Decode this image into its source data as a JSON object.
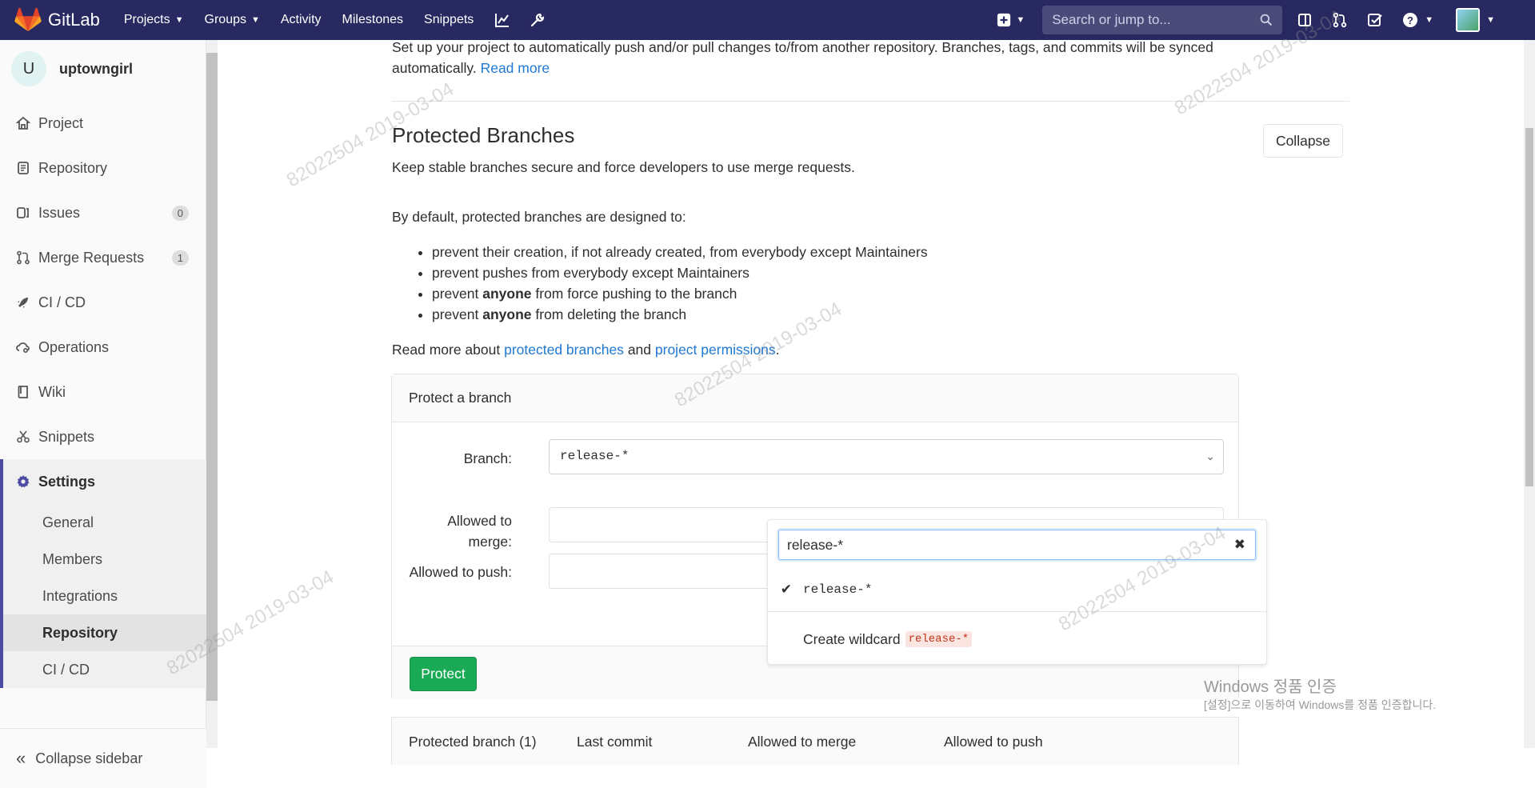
{
  "topbar": {
    "brand": "GitLab",
    "nav": [
      {
        "label": "Projects",
        "has_dropdown": true
      },
      {
        "label": "Groups",
        "has_dropdown": true
      },
      {
        "label": "Activity",
        "has_dropdown": false
      },
      {
        "label": "Milestones",
        "has_dropdown": false
      },
      {
        "label": "Snippets",
        "has_dropdown": false
      }
    ],
    "tools": [
      "chart-icon",
      "wrench-icon"
    ],
    "search_placeholder": "Search or jump to...",
    "right_icons": [
      "sidebar-toggle-icon",
      "merge-request-icon",
      "todo-icon",
      "help-icon"
    ],
    "colors": {
      "topbar": "#292961",
      "accent": "#1f78d1",
      "success": "#1aaa55"
    }
  },
  "sidebar": {
    "project_initial": "U",
    "project_name": "uptowngirl",
    "items": [
      {
        "label": "Project",
        "icon": "home-icon"
      },
      {
        "label": "Repository",
        "icon": "doc-icon"
      },
      {
        "label": "Issues",
        "icon": "issues-icon",
        "badge": "0"
      },
      {
        "label": "Merge Requests",
        "icon": "merge-request-icon",
        "badge": "1"
      },
      {
        "label": "CI / CD",
        "icon": "rocket-icon"
      },
      {
        "label": "Operations",
        "icon": "cloud-gear-icon"
      },
      {
        "label": "Wiki",
        "icon": "book-icon"
      },
      {
        "label": "Snippets",
        "icon": "scissors-icon"
      },
      {
        "label": "Settings",
        "icon": "gear-icon",
        "active": true
      }
    ],
    "settings_sub": [
      {
        "label": "General"
      },
      {
        "label": "Members"
      },
      {
        "label": "Integrations"
      },
      {
        "label": "Repository",
        "active": true
      },
      {
        "label": "CI / CD"
      }
    ],
    "collapse_label": "Collapse sidebar"
  },
  "main": {
    "mirror_text": "Set up your project to automatically push and/or pull changes to/from another repository. Branches, tags, and commits will be synced",
    "mirror_text2": "automatically.",
    "read_more": "Read more",
    "title": "Protected Branches",
    "collapse_btn": "Collapse",
    "subtitle": "Keep stable branches secure and force developers to use merge requests.",
    "default_intro": "By default, protected branches are designed to:",
    "rules": [
      {
        "pre": "prevent their creation, if not already created, from everybody except Maintainers",
        "bold": "",
        "post": ""
      },
      {
        "pre": "prevent pushes from everybody except Maintainers",
        "bold": "",
        "post": ""
      },
      {
        "pre": "prevent ",
        "bold": "anyone",
        "post": " from force pushing to the branch"
      },
      {
        "pre": "prevent ",
        "bold": "anyone",
        "post": " from deleting the branch"
      }
    ],
    "read_more_about": "Read more about",
    "link_protected": "protected branches",
    "and": "and",
    "link_permissions": "project permissions",
    "period": "."
  },
  "form": {
    "panel_title": "Protect a branch",
    "branch_label": "Branch:",
    "branch_value": "release-*",
    "merge_label": "Allowed to merge:",
    "push_label": "Allowed to push:",
    "protect_btn": "Protect"
  },
  "dropdown": {
    "search_value": "release-*",
    "selected_item": "release-*",
    "create_label": "Create wildcard",
    "create_chip": "release-*"
  },
  "table": {
    "headers": [
      "Protected branch (1)",
      "Last commit",
      "Allowed to merge",
      "Allowed to push"
    ]
  },
  "windows_watermark": {
    "line1": "Windows 정품 인증",
    "line2": "[설정]으로 이동하여 Windows를 정품 인증합니다."
  },
  "watermark_text": "82022504  2019-03-04"
}
